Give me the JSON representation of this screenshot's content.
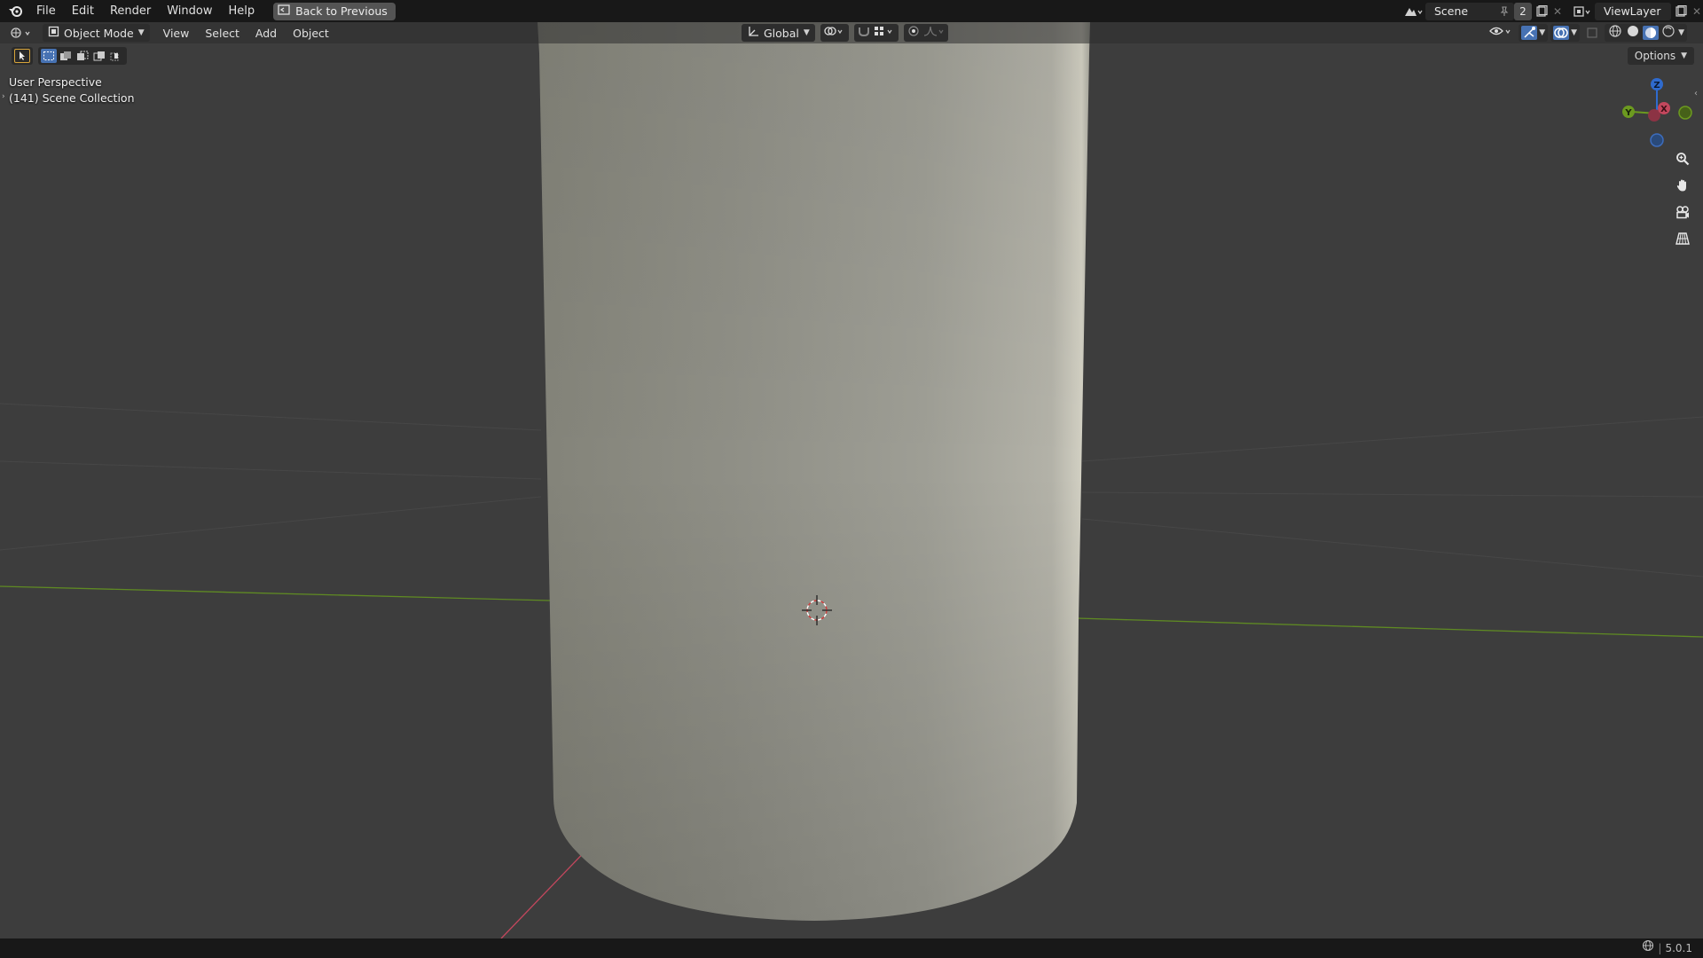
{
  "menu": {
    "items": [
      "File",
      "Edit",
      "Render",
      "Window",
      "Help"
    ],
    "back_label": "Back to Previous"
  },
  "top_right": {
    "scene_name": "Scene",
    "scene_users": "2",
    "view_layer": "ViewLayer"
  },
  "header": {
    "mode": "Object Mode",
    "menus": [
      "View",
      "Select",
      "Add",
      "Object"
    ],
    "orientation": "Global"
  },
  "tools": {
    "options_label": "Options"
  },
  "viewport": {
    "perspective_label": "User Perspective",
    "collection_label": "(141) Scene Collection"
  },
  "gizmo": {
    "z": "Z",
    "y": "Y",
    "x": "X"
  },
  "status": {
    "version": "5.0.1"
  },
  "colors": {
    "select_blue": "#4772b3",
    "axis_x": "#c3475d",
    "axis_y": "#6c9a1f",
    "axis_z": "#2f6bce"
  }
}
